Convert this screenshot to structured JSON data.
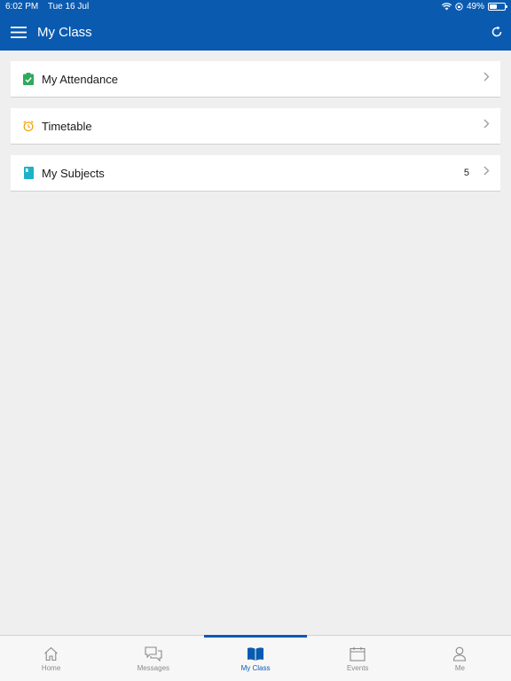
{
  "status": {
    "time": "6:02 PM",
    "date": "Tue 16 Jul",
    "battery": "49%",
    "battery_level": 0.49
  },
  "header": {
    "title": "My Class"
  },
  "items": [
    {
      "label": "My Attendance",
      "icon": "attendance-clipboard-icon",
      "color": "#2eaa5c"
    },
    {
      "label": "Timetable",
      "icon": "alarm-clock-icon",
      "color": "#f0a000"
    },
    {
      "label": "My Subjects",
      "icon": "book-icon",
      "color": "#1cb3c8",
      "count": "5"
    }
  ],
  "tabs": [
    {
      "label": "Home",
      "icon": "home-icon"
    },
    {
      "label": "Messages",
      "icon": "messages-icon"
    },
    {
      "label": "My Class",
      "icon": "open-book-icon",
      "active": true
    },
    {
      "label": "Events",
      "icon": "calendar-icon"
    },
    {
      "label": "Me",
      "icon": "person-icon"
    }
  ],
  "colors": {
    "brand": "#0a5bb0",
    "background": "#efeff0",
    "inactive_tab": "#8a8a8a"
  }
}
